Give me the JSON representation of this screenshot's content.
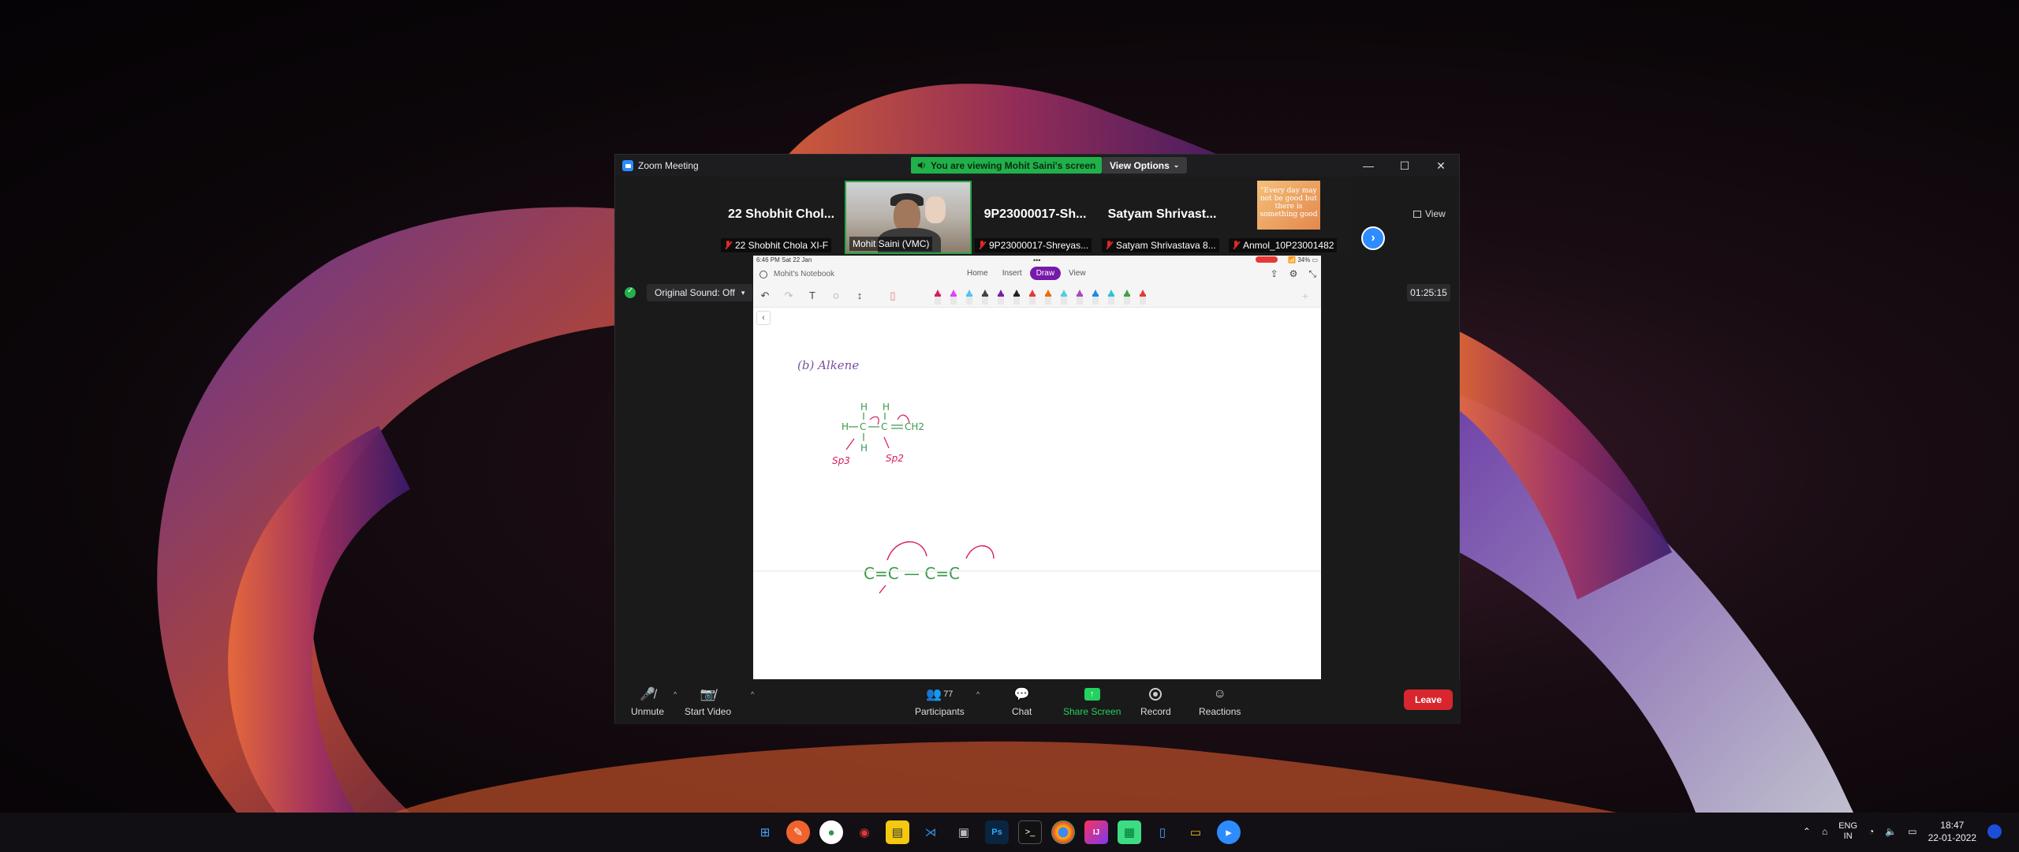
{
  "window": {
    "title": "Zoom Meeting",
    "viewing_banner": "You are viewing Mohit Saini's screen",
    "view_options": "View Options",
    "controls": [
      "—",
      "☐",
      "✕"
    ]
  },
  "participants_strip": [
    {
      "big_name": "22 Shobhit Chol...",
      "caption": "22 Shobhit Chola XI-F",
      "muted": true
    },
    {
      "big_name": "",
      "caption": "Mohit Saini (VMC)",
      "muted": false,
      "active": true
    },
    {
      "big_name": "9P23000017-Sh...",
      "caption": "9P23000017-Shreyas...",
      "muted": true
    },
    {
      "big_name": "Satyam  Shrivast...",
      "caption": "Satyam Shrivastava 8...",
      "muted": true
    },
    {
      "big_name": "",
      "caption": "Anmol_10P23001482",
      "muted": true,
      "quote": "\"Every day may not be good but there is something good"
    }
  ],
  "view_button": "View",
  "original_sound": "Original Sound: Off",
  "timer": "01:25:15",
  "ipad": {
    "status_time": "6:46 PM   Sat 22 Jan",
    "battery": "34%",
    "notebook_name": "Mohit's Notebook",
    "tabs": [
      "Home",
      "Insert",
      "Draw",
      "View"
    ],
    "active_tab": "Draw",
    "pen_colors": [
      "#d81b60",
      "#e040fb",
      "#4fc3f7",
      "#424242",
      "#7b1fa2",
      "#212121",
      "#e53935",
      "#ef6c00",
      "#4dd0e1",
      "#ab47bc",
      "#1e88e5",
      "#26c6da",
      "#43a047",
      "#e53935"
    ],
    "handwriting": {
      "heading": "(b)   Alkene",
      "labels_green": [
        "H",
        "H",
        "H",
        "C",
        "C",
        "CH2",
        "H"
      ],
      "labels_pink": [
        "Sp3",
        "Sp2"
      ],
      "bottom_formula": "C=C — C=C"
    }
  },
  "bottom_toolbar": {
    "unmute": "Unmute",
    "start_video": "Start Video",
    "participants": "Participants",
    "participants_count": "77",
    "chat": "Chat",
    "share_screen": "Share Screen",
    "record": "Record",
    "reactions": "Reactions",
    "leave": "Leave"
  },
  "taskbar": {
    "lang_1": "ENG",
    "lang_2": "IN",
    "time": "18:47",
    "date": "22-01-2022"
  }
}
